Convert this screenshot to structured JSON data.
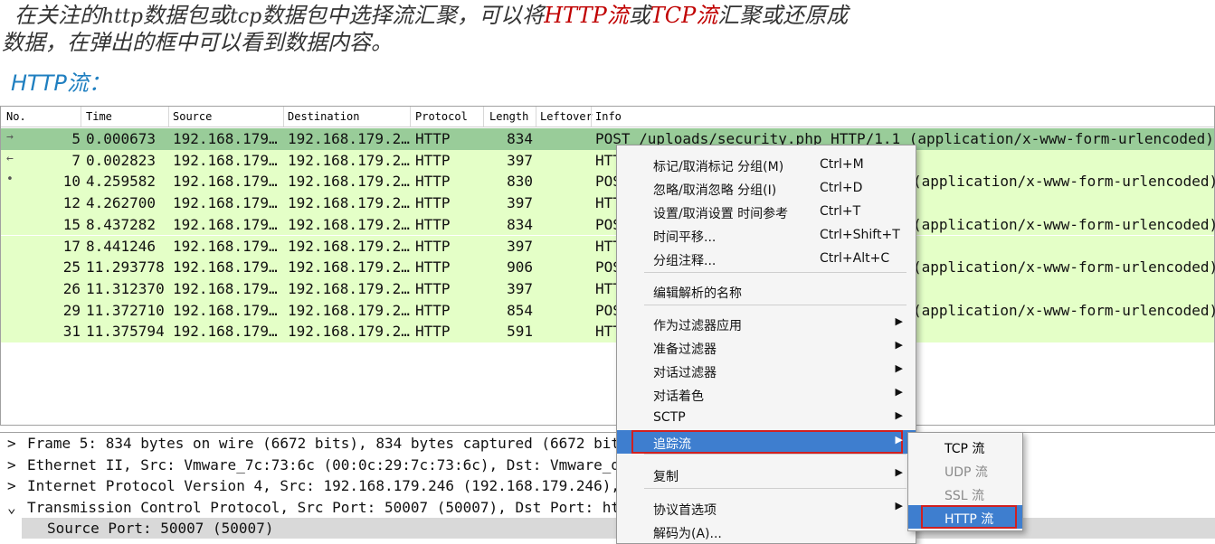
{
  "intro": {
    "line1_parts": [
      {
        "text": "在关注的",
        "style": "normal"
      },
      {
        "text": "http",
        "style": "serif"
      },
      {
        "text": "数据包或",
        "style": "normal"
      },
      {
        "text": "tcp",
        "style": "serif"
      },
      {
        "text": "数据包中选择流汇聚，可以将",
        "style": "normal"
      },
      {
        "text": "HTTP流",
        "style": "red"
      },
      {
        "text": "或",
        "style": "normal"
      },
      {
        "text": "TCP流",
        "style": "red"
      },
      {
        "text": "汇聚或还原成",
        "style": "normal"
      }
    ],
    "line2": "数据，在弹出的框中可以看到数据内容。",
    "subheading": "HTTP流：",
    "colors": {
      "text": "#333333",
      "highlight": "#c00000",
      "subheading": "#1f7fc0"
    }
  },
  "packet_list": {
    "columns": [
      "No.",
      "Time",
      "Source",
      "Destination",
      "Protocol",
      "Length",
      "Leftover",
      "Info"
    ],
    "rows": [
      {
        "no": "5",
        "time": "0.000673",
        "src": "192.168.179…",
        "dst": "192.168.179.2…",
        "proto": "HTTP",
        "len": "834",
        "info": "POST /uploads/security.php HTTP/1.1  (application/x-www-form-urlencoded)",
        "state": "selected",
        "arrow": "→"
      },
      {
        "no": "7",
        "time": "0.002823",
        "src": "192.168.179…",
        "dst": "192.168.179.2…",
        "proto": "HTTP",
        "len": "397",
        "info": "HTT",
        "state": "normal",
        "arrow": "←"
      },
      {
        "no": "10",
        "time": "4.259582",
        "src": "192.168.179…",
        "dst": "192.168.179.2…",
        "proto": "HTTP",
        "len": "830",
        "info": "POS",
        "info_right": "(application/x-www-form-urlencoded)",
        "state": "normal",
        "arrow": "•"
      },
      {
        "no": "12",
        "time": "4.262700",
        "src": "192.168.179…",
        "dst": "192.168.179.2…",
        "proto": "HTTP",
        "len": "397",
        "info": "HTT",
        "state": "normal",
        "arrow": ""
      },
      {
        "no": "15",
        "time": "8.437282",
        "src": "192.168.179…",
        "dst": "192.168.179.2…",
        "proto": "HTTP",
        "len": "834",
        "info": "POS",
        "info_right": "(application/x-www-form-urlencoded)",
        "state": "normal",
        "arrow": ""
      },
      {
        "no": "17",
        "time": "8.441246",
        "src": "192.168.179…",
        "dst": "192.168.179.2…",
        "proto": "HTTP",
        "len": "397",
        "info": "HTT",
        "state": "normal",
        "arrow": ""
      },
      {
        "no": "25",
        "time": "11.293778",
        "src": "192.168.179…",
        "dst": "192.168.179.2…",
        "proto": "HTTP",
        "len": "906",
        "info": "POS",
        "info_right": "(application/x-www-form-urlencoded)",
        "state": "normal",
        "arrow": ""
      },
      {
        "no": "26",
        "time": "11.312370",
        "src": "192.168.179…",
        "dst": "192.168.179.2…",
        "proto": "HTTP",
        "len": "397",
        "info": "HTT",
        "state": "normal",
        "arrow": ""
      },
      {
        "no": "29",
        "time": "11.372710",
        "src": "192.168.179…",
        "dst": "192.168.179.2…",
        "proto": "HTTP",
        "len": "854",
        "info": "POS",
        "info_right": "(application/x-www-form-urlencoded)",
        "state": "normal",
        "arrow": ""
      },
      {
        "no": "31",
        "time": "11.375794",
        "src": "192.168.179…",
        "dst": "192.168.179.2…",
        "proto": "HTTP",
        "len": "591",
        "info": "HTT",
        "state": "normal",
        "arrow": ""
      }
    ],
    "colors": {
      "selected": "#99cc99",
      "http_row": "#e4ffc7"
    }
  },
  "details": {
    "rows": [
      {
        "toggle": ">",
        "text": "Frame 5: 834 bytes on wire (6672 bits), 834 bytes captured (6672 bits"
      },
      {
        "toggle": ">",
        "text": "Ethernet II, Src: Vmware_7c:73:6c (00:0c:29:7c:73:6c), Dst: Vmware_d6"
      },
      {
        "toggle": ">",
        "text": "Internet Protocol Version 4, Src: 192.168.179.246 (192.168.179.246),"
      },
      {
        "toggle": "⌄",
        "text": "Transmission Control Protocol, Src Port: 50007 (50007), Dst Port: htt"
      },
      {
        "toggle": "",
        "text": "Source Port: 50007 (50007)",
        "highlight": true
      }
    ]
  },
  "context_menu": {
    "items": [
      {
        "label": "标记/取消标记 分组(M)",
        "shortcut": "Ctrl+M"
      },
      {
        "label": "忽略/取消忽略 分组(I)",
        "shortcut": "Ctrl+D"
      },
      {
        "label": "设置/取消设置 时间参考",
        "shortcut": "Ctrl+T"
      },
      {
        "label": "时间平移...",
        "shortcut": "Ctrl+Shift+T"
      },
      {
        "label": "分组注释...",
        "shortcut": "Ctrl+Alt+C"
      },
      {
        "label": "编辑解析的名称",
        "shortcut": ""
      },
      {
        "label": "作为过滤器应用",
        "shortcut": "",
        "submenu": true
      },
      {
        "label": "准备过滤器",
        "shortcut": "",
        "submenu": true
      },
      {
        "label": "对话过滤器",
        "shortcut": "",
        "submenu": true
      },
      {
        "label": "对话着色",
        "shortcut": "",
        "submenu": true
      },
      {
        "label": "SCTP",
        "shortcut": "",
        "submenu": true
      },
      {
        "label": "追踪流",
        "shortcut": "",
        "submenu": true,
        "active": true
      },
      {
        "label": "复制",
        "shortcut": "",
        "submenu": true
      },
      {
        "label": "协议首选项",
        "shortcut": "",
        "submenu": true
      },
      {
        "label": "解码为(A)...",
        "shortcut": ""
      }
    ],
    "submenu_arrow": "▶",
    "accent": "#3e7ecf",
    "annotation_color": "#d02020"
  },
  "follow_submenu": {
    "items": [
      {
        "label": "TCP 流",
        "state": "enabled"
      },
      {
        "label": "UDP 流",
        "state": "disabled"
      },
      {
        "label": "SSL 流",
        "state": "disabled"
      },
      {
        "label": "HTTP 流",
        "state": "active"
      }
    ]
  }
}
